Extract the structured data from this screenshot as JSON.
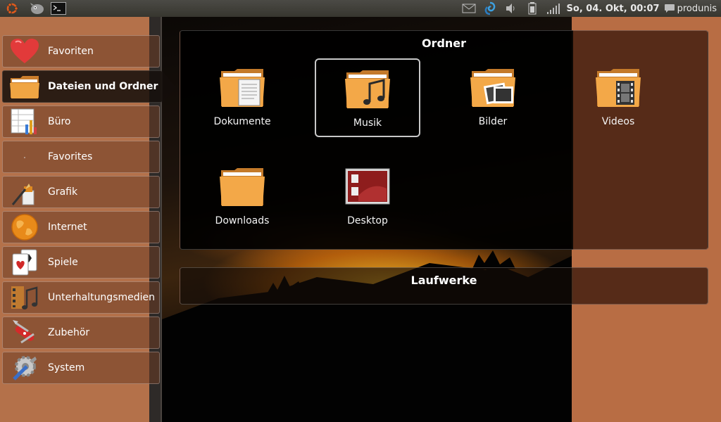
{
  "top_panel": {
    "left_icons": [
      "ubuntu-logo-icon",
      "gimp-icon",
      "terminal-icon"
    ],
    "right_icons": [
      "mail-icon",
      "network-swirl-icon",
      "volume-icon",
      "battery-icon",
      "signal-icon"
    ],
    "clock": "So, 04. Okt, 00:07",
    "user": "produnis"
  },
  "sidebar": {
    "items": [
      {
        "label": "Favoriten",
        "icon": "heart-icon"
      },
      {
        "label": "Dateien und Ordner",
        "icon": "folder-icon",
        "active": true
      },
      {
        "label": "Büro",
        "icon": "spreadsheet-icon"
      },
      {
        "label": "Favorites",
        "icon": "empty-icon"
      },
      {
        "label": "Grafik",
        "icon": "paint-brush-icon"
      },
      {
        "label": "Internet",
        "icon": "globe-icon"
      },
      {
        "label": "Spiele",
        "icon": "playing-cards-icon"
      },
      {
        "label": "Unterhaltungsmedien",
        "icon": "media-icon"
      },
      {
        "label": "Zubehör",
        "icon": "swiss-knife-icon"
      },
      {
        "label": "System",
        "icon": "gears-icon"
      }
    ]
  },
  "ordner": {
    "title": "Ordner",
    "folders": [
      {
        "label": "Dokumente",
        "icon": "documents-folder-icon"
      },
      {
        "label": "Musik",
        "icon": "music-folder-icon",
        "selected": true
      },
      {
        "label": "Bilder",
        "icon": "pictures-folder-icon"
      },
      {
        "label": "Videos",
        "icon": "videos-folder-icon"
      },
      {
        "label": "Downloads",
        "icon": "downloads-folder-icon"
      },
      {
        "label": "Desktop",
        "icon": "desktop-folder-icon"
      }
    ]
  },
  "laufwerke": {
    "title": "Laufwerke"
  },
  "colors": {
    "accent_brown": "#b4704a",
    "panel_dark": "#000000",
    "highlight_border": "#c8c8c8"
  }
}
